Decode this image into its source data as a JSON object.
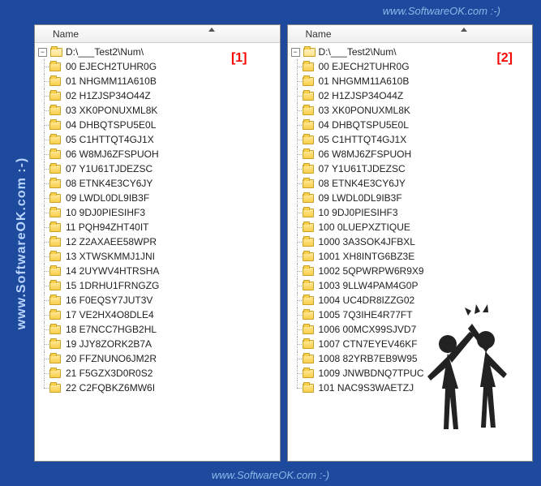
{
  "watermark": {
    "side": "www.SoftwareOK.com :-)",
    "top": "www.SoftwareOK.com :-)",
    "bottom": "www.SoftwareOK.com :-)"
  },
  "panes": [
    {
      "header": "Name",
      "badge": "[1]",
      "root": "D:\\___Test2\\Num\\",
      "items": [
        "00 EJECH2TUHR0G",
        "01 NHGMM11A610B",
        "02 H1ZJSP34O44Z",
        "03 XK0PONUXML8K",
        "04 DHBQTSPU5E0L",
        "05 C1HTTQT4GJ1X",
        "06 W8MJ6ZFSPUOH",
        "07 Y1U61TJDEZSC",
        "08 ETNK4E3CY6JY",
        "09 LWDL0DL9IB3F",
        "10 9DJ0PIESIHF3",
        "11 PQH94ZHT40IT",
        "12 Z2AXAEE58WPR",
        "13 XTWSKMMJ1JNI",
        "14 2UYWV4HTRSHA",
        "15 1DRHU1FRNGZG",
        "16 F0EQSY7JUT3V",
        "17 VE2HX4O8DLE4",
        "18 E7NCC7HGB2HL",
        "19 JJY8ZORK2B7A",
        "20 FFZNUNO6JM2R",
        "21 F5GZX3D0R0S2",
        "22 C2FQBKZ6MW6I"
      ]
    },
    {
      "header": "Name",
      "badge": "[2]",
      "root": "D:\\___Test2\\Num\\",
      "items": [
        "00 EJECH2TUHR0G",
        "01 NHGMM11A610B",
        "02 H1ZJSP34O44Z",
        "03 XK0PONUXML8K",
        "04 DHBQTSPU5E0L",
        "05 C1HTTQT4GJ1X",
        "06 W8MJ6ZFSPUOH",
        "07 Y1U61TJDEZSC",
        "08 ETNK4E3CY6JY",
        "09 LWDL0DL9IB3F",
        "10 9DJ0PIESIHF3",
        "100 0LUEPXZTIQUE",
        "1000 3A3SOK4JFBXL",
        "1001 XH8INTG6BZ3E",
        "1002 5QPWRPW6R9X9",
        "1003 9LLW4PAM4G0P",
        "1004 UC4DR8IZZG02",
        "1005 7Q3IHE4R77FT",
        "1006 00MCX99SJVD7",
        "1007 CTN7EYEV46KF",
        "1008 82YRB7EB9W95",
        "1009 JNWBDNQ7TPUC",
        "101 NAC9S3WAETZJ"
      ]
    }
  ]
}
